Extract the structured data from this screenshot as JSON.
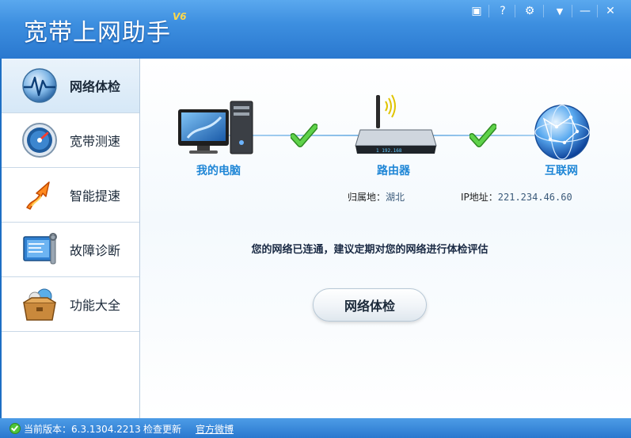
{
  "window": {
    "title": "宽带上网助手",
    "version_badge": "V6",
    "buttons": {
      "skin": "▣",
      "help": "?",
      "settings": "⚙",
      "menu": "▼",
      "minimize": "—",
      "close": "✕"
    }
  },
  "sidebar": {
    "items": [
      {
        "label": "网络体检",
        "icon": "heartbeat-globe-icon",
        "active": true
      },
      {
        "label": "宽带测速",
        "icon": "speedometer-icon",
        "active": false
      },
      {
        "label": "智能提速",
        "icon": "rocket-arrow-icon",
        "active": false
      },
      {
        "label": "故障诊断",
        "icon": "wrench-screen-icon",
        "active": false
      },
      {
        "label": "功能大全",
        "icon": "toolbox-icon",
        "active": false
      }
    ]
  },
  "main": {
    "nodes": {
      "computer": "我的电脑",
      "router": "路由器",
      "internet": "互联网"
    },
    "location_label": "归属地：",
    "location_value": "湖北",
    "ip_label": "IP地址：",
    "ip_value": "221.234.46.60",
    "status_message": "您的网络已连通，建议定期对您的网络进行体检评估",
    "check_button": "网络体检"
  },
  "statusbar": {
    "version_label": "当前版本：",
    "version_value": "6.3.1304.2213",
    "check_update": "检查更新",
    "weibo": "官方微博"
  },
  "colors": {
    "title_bar": "#3d8fe0",
    "node_label": "#1f86d6",
    "check_mark": "#4fc43a",
    "version_badge": "#ffd84a"
  }
}
